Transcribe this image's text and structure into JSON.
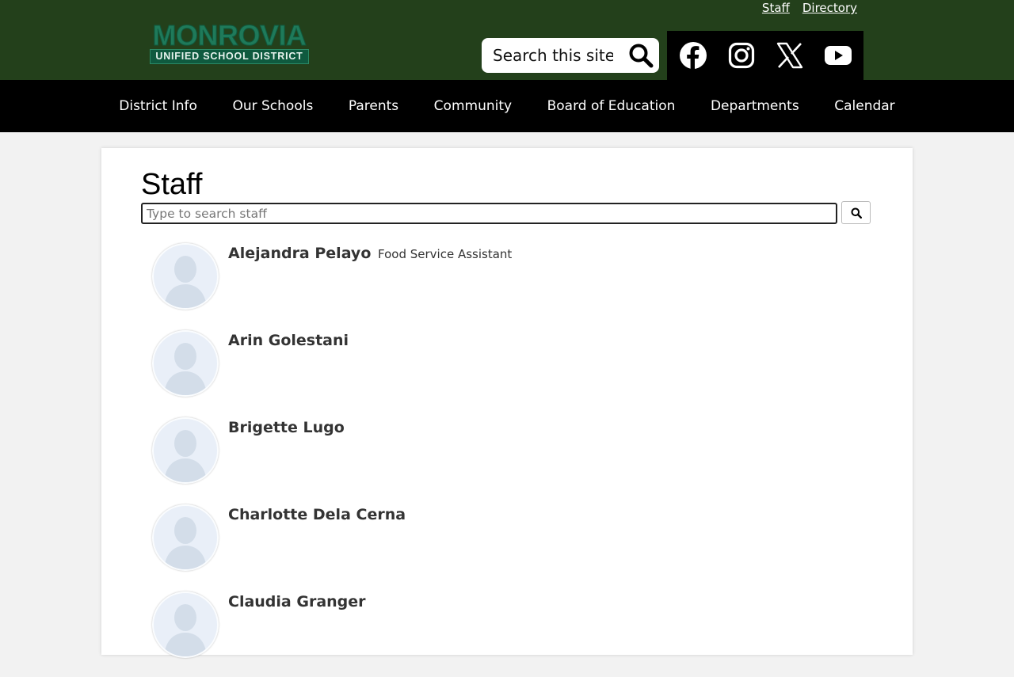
{
  "header": {
    "utility_links": [
      "Staff",
      "Directory"
    ],
    "logo_text": "MONROVIA",
    "logo_subtext": "UNIFIED SCHOOL DISTRICT",
    "search_placeholder": "Search this site",
    "social": [
      "facebook-icon",
      "instagram-icon",
      "x-icon",
      "youtube-icon"
    ],
    "colors": {
      "header_green": "#23401b",
      "nav_black": "#000000",
      "logo_green": "#1f7a5a"
    }
  },
  "nav": {
    "items": [
      "District Info",
      "Our Schools",
      "Parents",
      "Community",
      "Board of Education",
      "Departments",
      "Calendar"
    ]
  },
  "main": {
    "title": "Staff",
    "search_placeholder": "Type to search staff",
    "staff": [
      {
        "name": "Alejandra Pelayo",
        "title": "Food Service Assistant"
      },
      {
        "name": "Arin Golestani",
        "title": ""
      },
      {
        "name": "Brigette Lugo",
        "title": ""
      },
      {
        "name": "Charlotte Dela Cerna",
        "title": ""
      },
      {
        "name": "Claudia Granger",
        "title": ""
      }
    ]
  }
}
